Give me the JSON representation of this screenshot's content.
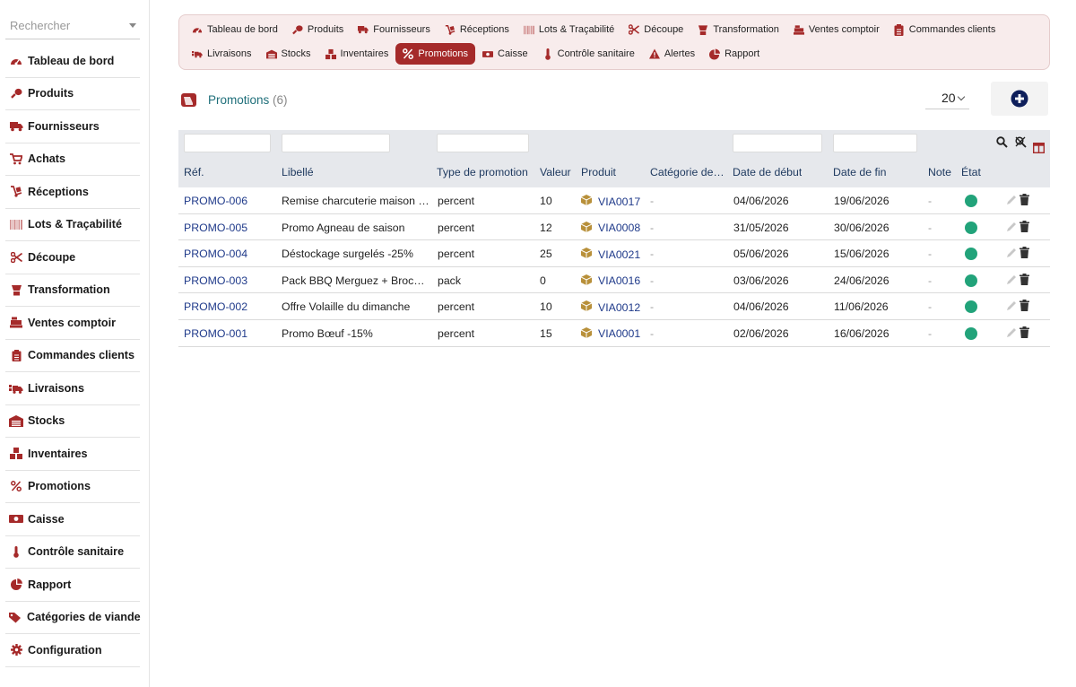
{
  "search": {
    "placeholder": "Rechercher"
  },
  "sidebar": {
    "items": [
      {
        "label": "Tableau de bord",
        "icon": "gauge-icon"
      },
      {
        "label": "Produits",
        "icon": "drumstick-icon"
      },
      {
        "label": "Fournisseurs",
        "icon": "truck-icon"
      },
      {
        "label": "Achats",
        "icon": "cart-icon"
      },
      {
        "label": "Réceptions",
        "icon": "dolly-icon"
      },
      {
        "label": "Lots & Traçabilité",
        "icon": "barcode-icon"
      },
      {
        "label": "Découpe",
        "icon": "scissors-icon"
      },
      {
        "label": "Transformation",
        "icon": "blender-icon"
      },
      {
        "label": "Ventes comptoir",
        "icon": "cash-register-icon"
      },
      {
        "label": "Commandes clients",
        "icon": "clipboard-icon"
      },
      {
        "label": "Livraisons",
        "icon": "shipping-icon"
      },
      {
        "label": "Stocks",
        "icon": "warehouse-icon"
      },
      {
        "label": "Inventaires",
        "icon": "boxes-icon"
      },
      {
        "label": "Promotions",
        "icon": "percent-icon"
      },
      {
        "label": "Caisse",
        "icon": "money-icon"
      },
      {
        "label": "Contrôle sanitaire",
        "icon": "thermometer-icon"
      },
      {
        "label": "Rapport",
        "icon": "pie-chart-icon"
      },
      {
        "label": "Catégories de viande",
        "icon": "tags-icon"
      },
      {
        "label": "Configuration",
        "icon": "gear-icon"
      }
    ]
  },
  "topnav": {
    "row1": [
      {
        "label": "Tableau de bord",
        "icon": "gauge-icon"
      },
      {
        "label": "Produits",
        "icon": "drumstick-icon"
      },
      {
        "label": "Fournisseurs",
        "icon": "truck-icon"
      },
      {
        "label": "Réceptions",
        "icon": "dolly-icon"
      },
      {
        "label": "Lots & Traçabilité",
        "icon": "barcode-icon"
      },
      {
        "label": "Découpe",
        "icon": "scissors-icon"
      },
      {
        "label": "Transformation",
        "icon": "blender-icon"
      },
      {
        "label": "Ventes comptoir",
        "icon": "cash-register-icon"
      },
      {
        "label": "Commandes clients",
        "icon": "clipboard-icon"
      }
    ],
    "row2": [
      {
        "label": "Livraisons",
        "icon": "shipping-icon"
      },
      {
        "label": "Stocks",
        "icon": "warehouse-icon"
      },
      {
        "label": "Inventaires",
        "icon": "boxes-icon"
      },
      {
        "label": "Promotions",
        "icon": "percent-icon",
        "active": true
      },
      {
        "label": "Caisse",
        "icon": "money-icon"
      },
      {
        "label": "Contrôle sanitaire",
        "icon": "thermometer-icon"
      },
      {
        "label": "Alertes",
        "icon": "warning-icon"
      },
      {
        "label": "Rapport",
        "icon": "pie-chart-icon"
      }
    ]
  },
  "list": {
    "title": "Promotions",
    "count": "(6)",
    "page_size": "20"
  },
  "table": {
    "columns": [
      "Réf.",
      "Libellé",
      "Type de promotion",
      "Valeur",
      "Produit",
      "Catégorie de…",
      "Date de début",
      "Date de fin",
      "Note",
      "État"
    ],
    "rows": [
      {
        "ref": "PROMO-006",
        "label": "Remise charcuterie maison …",
        "type": "percent",
        "value": "10",
        "product": "VIA0017",
        "category": "-",
        "start": "04/06/2026",
        "end": "19/06/2026",
        "note": "-"
      },
      {
        "ref": "PROMO-005",
        "label": "Promo Agneau de saison",
        "type": "percent",
        "value": "12",
        "product": "VIA0008",
        "category": "-",
        "start": "31/05/2026",
        "end": "30/06/2026",
        "note": "-"
      },
      {
        "ref": "PROMO-004",
        "label": "Déstockage surgelés -25%",
        "type": "percent",
        "value": "25",
        "product": "VIA0021",
        "category": "-",
        "start": "05/06/2026",
        "end": "15/06/2026",
        "note": "-"
      },
      {
        "ref": "PROMO-003",
        "label": "Pack BBQ Merguez + Broch…",
        "type": "pack",
        "value": "0",
        "product": "VIA0016",
        "category": "-",
        "start": "03/06/2026",
        "end": "24/06/2026",
        "note": "-"
      },
      {
        "ref": "PROMO-002",
        "label": "Offre Volaille du dimanche",
        "type": "percent",
        "value": "10",
        "product": "VIA0012",
        "category": "-",
        "start": "04/06/2026",
        "end": "11/06/2026",
        "note": "-"
      },
      {
        "ref": "PROMO-001",
        "label": "Promo Bœuf -15%",
        "type": "percent",
        "value": "15",
        "product": "VIA0001",
        "category": "-",
        "start": "02/06/2026",
        "end": "16/06/2026",
        "note": "-"
      }
    ]
  },
  "colors": {
    "accent": "#a52a2a",
    "status_active": "#22a37a",
    "link": "#1f3a8a",
    "title": "#1f6f7a"
  }
}
